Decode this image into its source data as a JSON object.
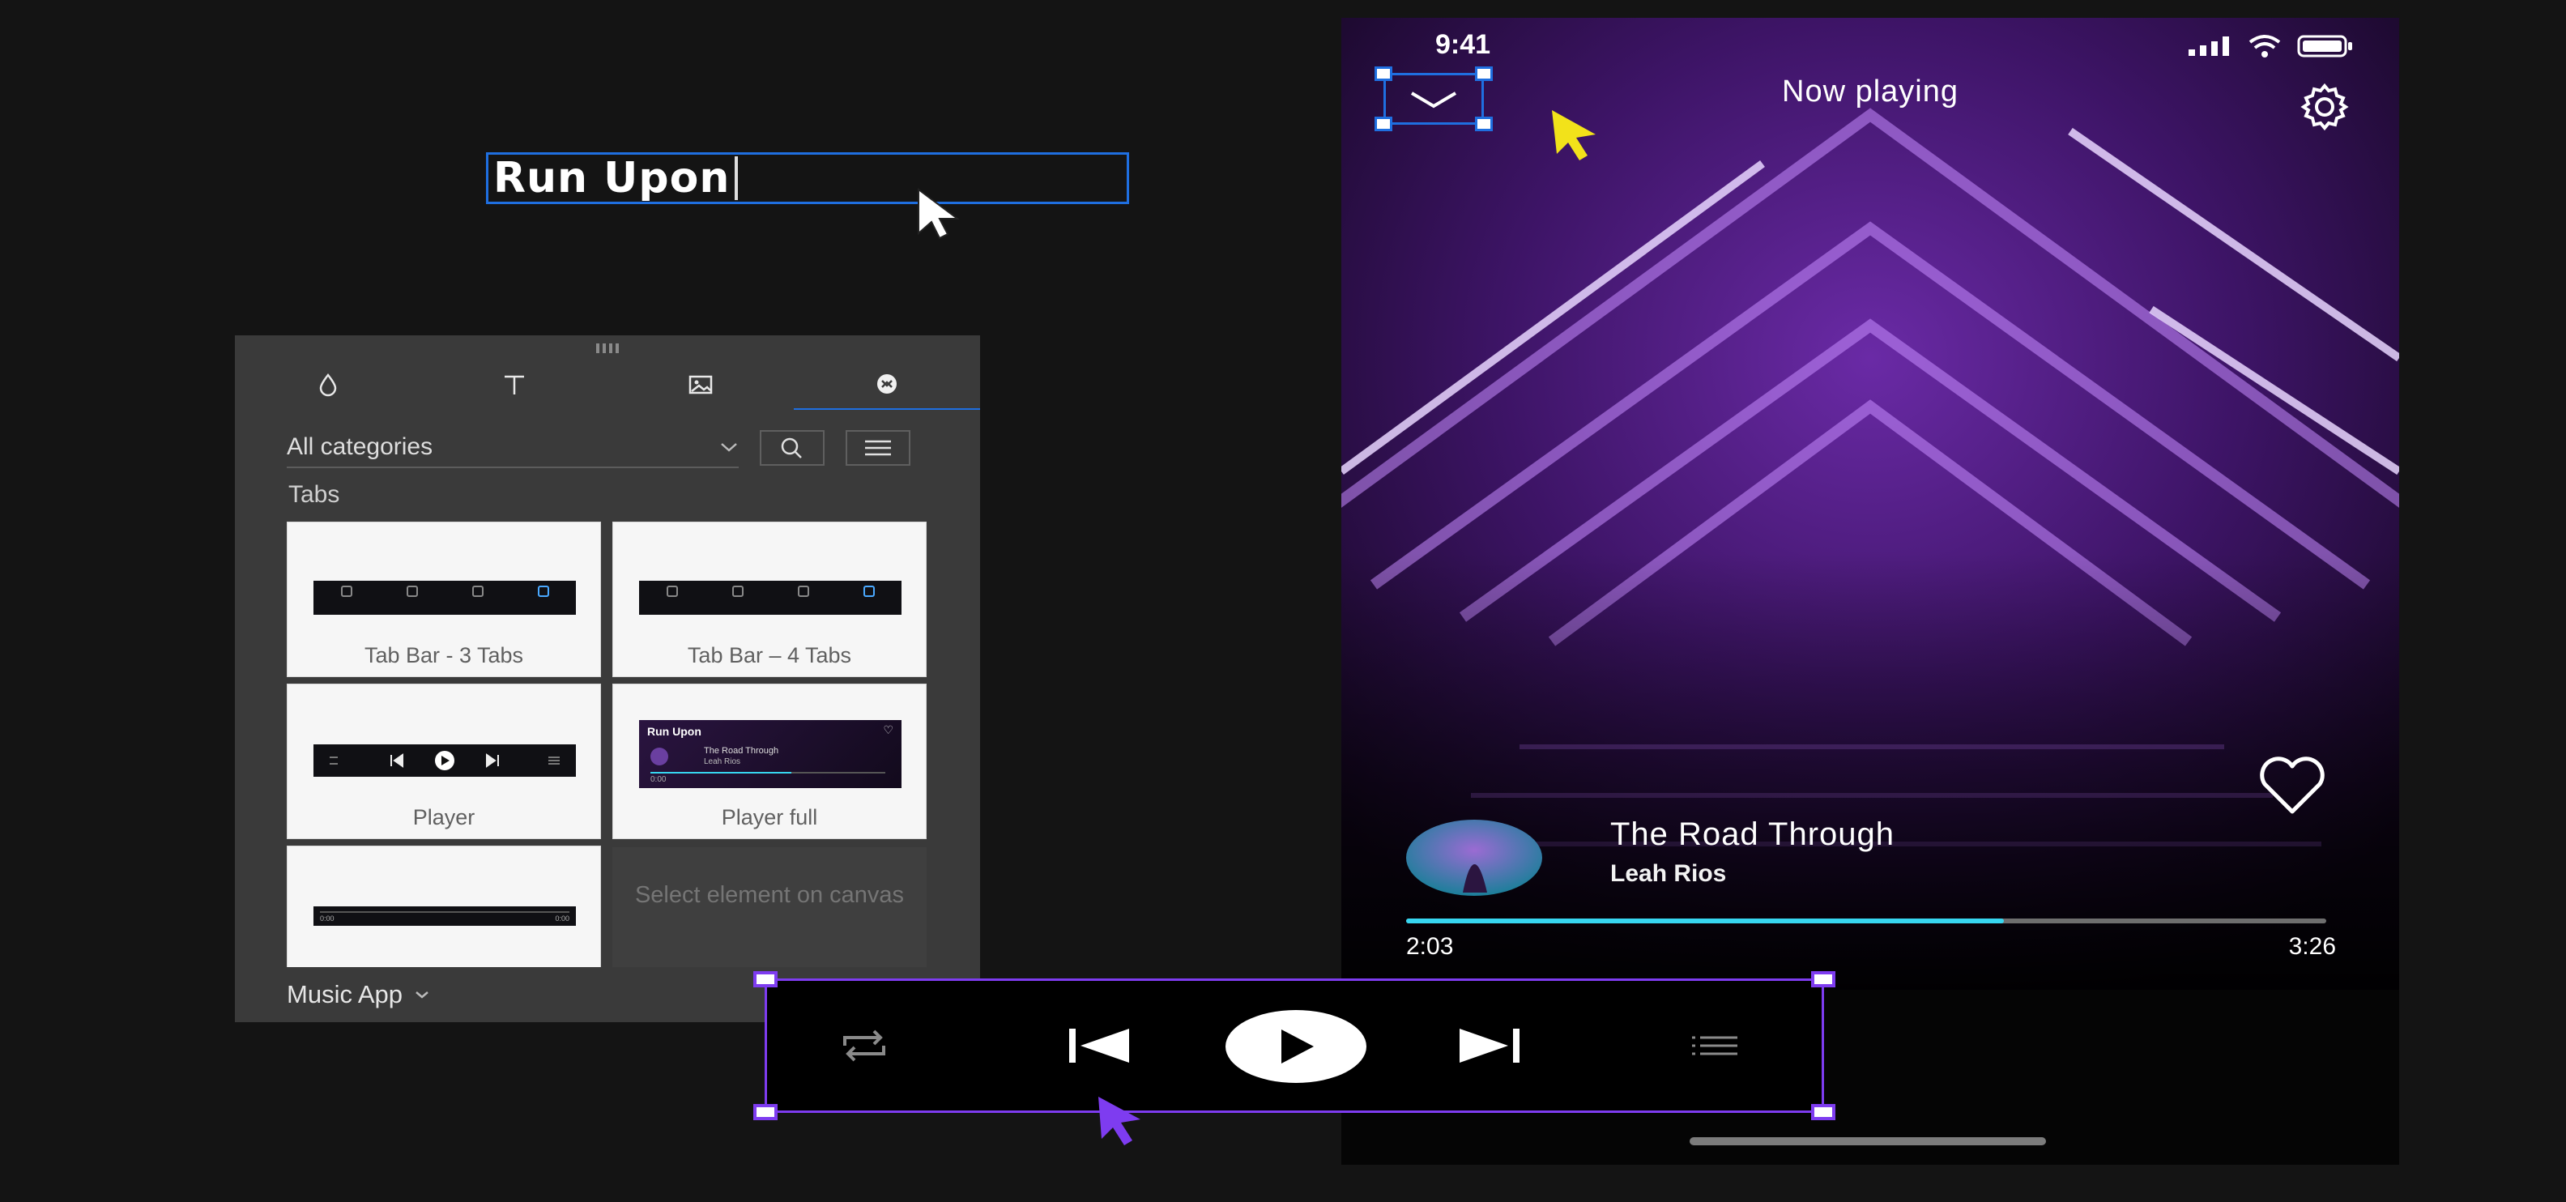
{
  "editor": {
    "title_field": {
      "value": "Run Upon"
    }
  },
  "assets_panel": {
    "tabs": [
      {
        "name": "colors",
        "icon": "droplet-icon"
      },
      {
        "name": "text",
        "icon": "text-icon"
      },
      {
        "name": "images",
        "icon": "image-icon"
      },
      {
        "name": "ui-kits",
        "icon": "ui-kit-icon",
        "active": true
      }
    ],
    "category": "All categories",
    "section_label": "Tabs",
    "cards": [
      {
        "label": "Tab Bar - 3 Tabs"
      },
      {
        "label": "Tab Bar – 4 Tabs"
      },
      {
        "label": "Player"
      },
      {
        "label": "Player full",
        "thumb_title": "Run Upon",
        "thumb_track": "The Road Through",
        "thumb_artist": "Leah Rios",
        "thumb_time": "0:00"
      },
      {
        "label": "",
        "thumb_time_left": "0:00",
        "thumb_time_right": "0:00"
      }
    ],
    "empty_card_text": "Select element on canvas",
    "footer": "Music App"
  },
  "phone": {
    "status_time": "9:41",
    "header_title": "Now playing",
    "track_title": "The Road Through",
    "track_artist": "Leah Rios",
    "time_elapsed": "2:03",
    "time_total": "3:26",
    "progress": 0.65,
    "accent": "#37d6f0"
  },
  "controls": {
    "buttons": [
      "repeat-icon",
      "skip-back-icon",
      "play-icon",
      "skip-forward-icon",
      "queue-icon"
    ]
  },
  "colors": {
    "selection_blue": "#1f6fe0",
    "selection_purple": "#7e3cf0",
    "cursor_yellow": "#f2e21a"
  }
}
